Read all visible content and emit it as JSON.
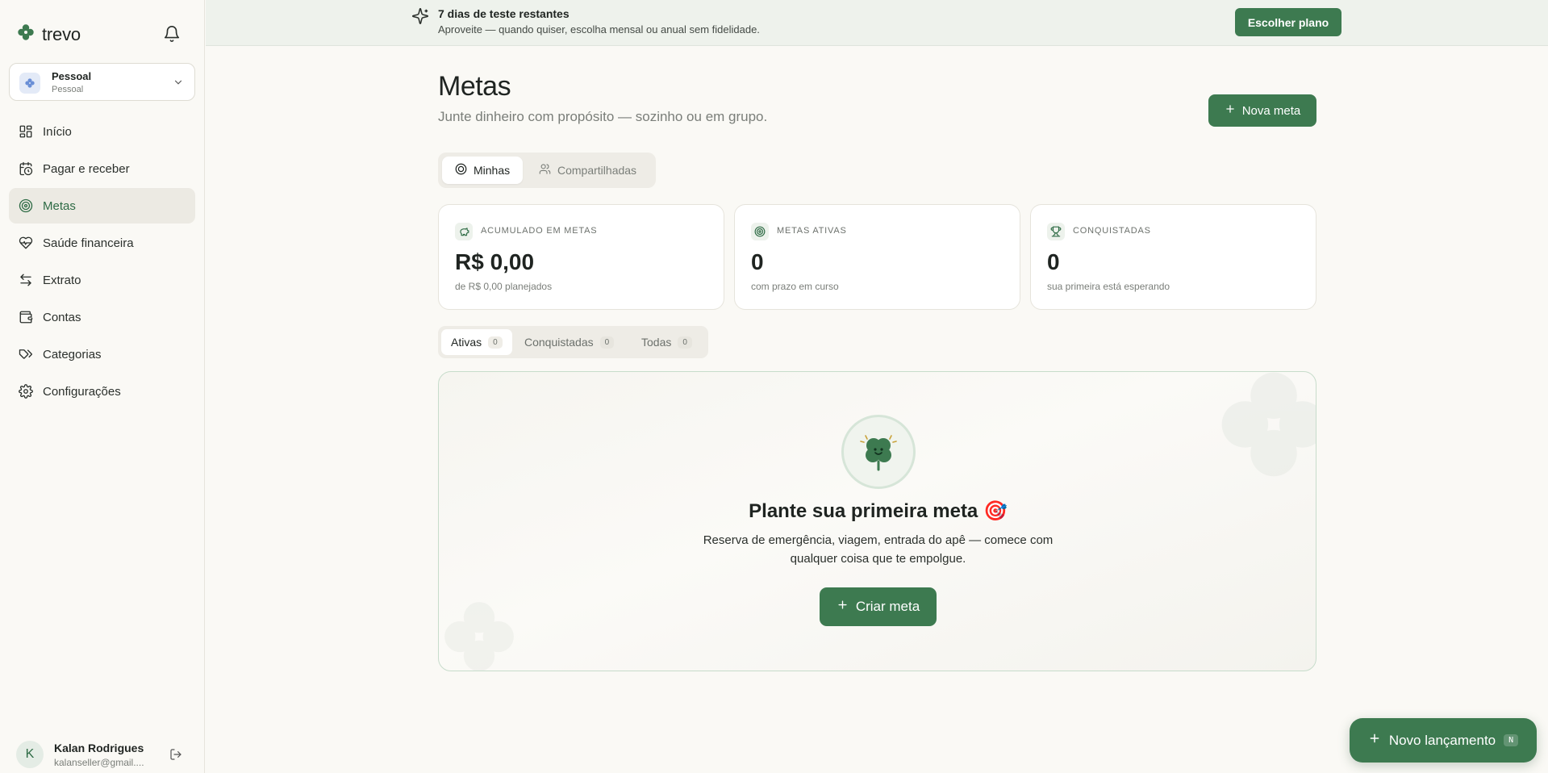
{
  "app": {
    "brand": "trevo"
  },
  "workspace": {
    "name": "Pessoal",
    "type": "Pessoal"
  },
  "sidebar": {
    "items": [
      {
        "label": "Início",
        "icon": "grid-icon"
      },
      {
        "label": "Pagar e receber",
        "icon": "calendar-clock-icon"
      },
      {
        "label": "Metas",
        "icon": "target-icon",
        "active": true
      },
      {
        "label": "Saúde financeira",
        "icon": "heart-pulse-icon"
      },
      {
        "label": "Extrato",
        "icon": "arrows-swap-icon"
      },
      {
        "label": "Contas",
        "icon": "wallet-icon"
      },
      {
        "label": "Categorias",
        "icon": "tags-icon"
      },
      {
        "label": "Configurações",
        "icon": "gear-icon"
      }
    ]
  },
  "user": {
    "initial": "K",
    "name": "Kalan Rodrigues",
    "email": "kalanseller@gmail...."
  },
  "banner": {
    "title": "7 dias de teste restantes",
    "subtitle": "Aproveite — quando quiser, escolha mensal ou anual sem fidelidade.",
    "cta": "Escolher plano"
  },
  "page": {
    "title": "Metas",
    "subtitle": "Junte dinheiro com propósito — sozinho ou em grupo.",
    "new_goal": "Nova meta"
  },
  "segments": {
    "mine": "Minhas",
    "shared": "Compartilhadas"
  },
  "stats": [
    {
      "label": "Acumulado em metas",
      "value": "R$ 0,00",
      "note": "de R$ 0,00 planejados",
      "icon": "piggy-bank-icon"
    },
    {
      "label": "Metas ativas",
      "value": "0",
      "note": "com prazo em curso",
      "icon": "target-icon"
    },
    {
      "label": "Conquistadas",
      "value": "0",
      "note": "sua primeira está esperando",
      "icon": "trophy-icon"
    }
  ],
  "filters": [
    {
      "label": "Ativas",
      "count": "0"
    },
    {
      "label": "Conquistadas",
      "count": "0"
    },
    {
      "label": "Todas",
      "count": "0"
    }
  ],
  "empty": {
    "title": "Plante sua primeira meta",
    "description": "Reserva de emergência, viagem, entrada do apê — comece com qualquer coisa que te empolgue.",
    "cta": "Criar meta"
  },
  "fab": {
    "label": "Novo lançamento",
    "shortcut": "N"
  },
  "colors": {
    "accent": "#3d7a50",
    "background": "#faf9f5"
  }
}
